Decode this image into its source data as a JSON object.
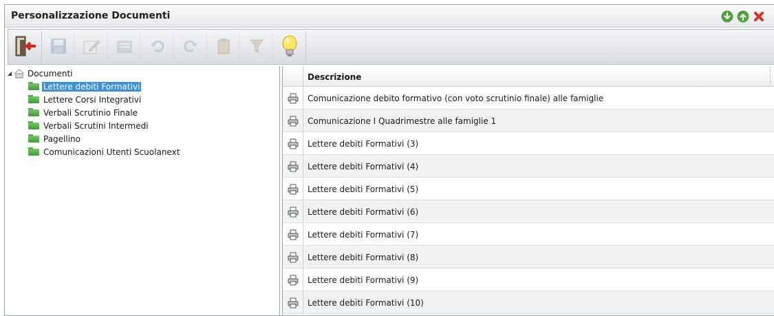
{
  "window": {
    "title": "Personalizzazione Documenti"
  },
  "window_buttons": [
    {
      "name": "download-icon",
      "color": "#4aa23a"
    },
    {
      "name": "upload-icon",
      "color": "#4aa23a"
    },
    {
      "name": "close-icon",
      "color": "#d4332b"
    }
  ],
  "toolbar": {
    "buttons": [
      {
        "name": "exit-icon",
        "enabled": true
      },
      {
        "name": "save-icon",
        "enabled": false
      },
      {
        "name": "edit-icon",
        "enabled": false
      },
      {
        "name": "delete-icon",
        "enabled": false
      },
      {
        "name": "undo-icon",
        "enabled": false
      },
      {
        "name": "redo-icon",
        "enabled": false
      },
      {
        "name": "paste-icon",
        "enabled": false
      },
      {
        "name": "filter-icon",
        "enabled": false
      },
      {
        "name": "lightbulb-icon",
        "enabled": true
      }
    ]
  },
  "tree": {
    "root_label": "Documenti",
    "items": [
      {
        "label": "Lettere debiti Formativi",
        "selected": true
      },
      {
        "label": "Lettere Corsi Integrativi",
        "selected": false
      },
      {
        "label": "Verbali Scrutinio Finale",
        "selected": false
      },
      {
        "label": "Verbali Scrutini Intermedi",
        "selected": false
      },
      {
        "label": "Pagellino",
        "selected": false
      },
      {
        "label": "Comunicazioni Utenti Scuolanext",
        "selected": false
      }
    ]
  },
  "grid": {
    "header": {
      "description": "Descrizione"
    },
    "rows": [
      {
        "description": "Comunicazione debito formativo (con voto scrutinio finale) alle famiglie"
      },
      {
        "description": "Comunicazione I Quadrimestre alle famiglie 1"
      },
      {
        "description": "Lettere debiti Formativi (3)"
      },
      {
        "description": "Lettere debiti Formativi (4)"
      },
      {
        "description": "Lettere debiti Formativi (5)"
      },
      {
        "description": "Lettere debiti Formativi (6)"
      },
      {
        "description": "Lettere debiti Formativi (7)"
      },
      {
        "description": "Lettere debiti Formativi (8)"
      },
      {
        "description": "Lettere debiti Formativi (9)"
      },
      {
        "description": "Lettere debiti Formativi (10)"
      }
    ]
  }
}
